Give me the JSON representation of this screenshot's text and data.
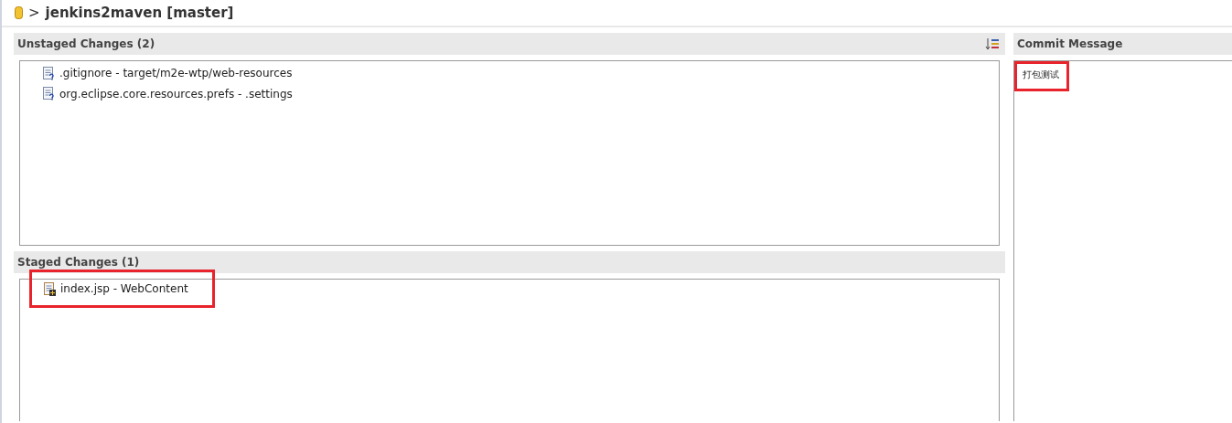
{
  "title": {
    "arrow": ">",
    "repository": "jenkins2maven [master]"
  },
  "unstaged": {
    "title": "Unstaged Changes (2)",
    "files": [
      {
        "kind": "untracked",
        "label": ".gitignore - target/m2e-wtp/web-resources",
        "annotated": false
      },
      {
        "kind": "untracked",
        "label": "org.eclipse.core.resources.prefs - .settings",
        "annotated": false
      }
    ]
  },
  "staged": {
    "title": "Staged Changes (1)",
    "files": [
      {
        "kind": "added",
        "label": "index.jsp - WebContent",
        "annotated": true
      }
    ]
  },
  "commit": {
    "title": "Commit Message",
    "message": "打包测试",
    "annotated": true
  }
}
